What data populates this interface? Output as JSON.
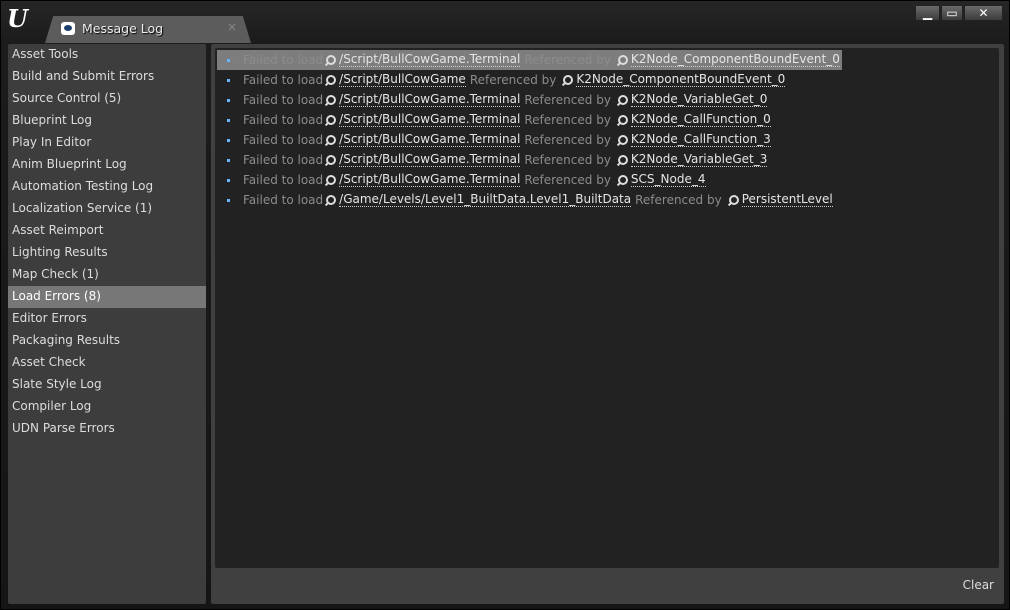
{
  "window": {
    "tab_title": "Message Log",
    "tab_close": "×",
    "minimize": "▁",
    "maximize": "▭",
    "close": "✕",
    "logo": "U"
  },
  "sidebar": {
    "items": [
      {
        "label": "Asset Tools"
      },
      {
        "label": "Build and Submit Errors"
      },
      {
        "label": "Source Control (5)"
      },
      {
        "label": "Blueprint Log"
      },
      {
        "label": "Play In Editor"
      },
      {
        "label": "Anim Blueprint Log"
      },
      {
        "label": "Automation Testing Log"
      },
      {
        "label": "Localization Service (1)"
      },
      {
        "label": "Asset Reimport"
      },
      {
        "label": "Lighting Results"
      },
      {
        "label": "Map Check (1)"
      },
      {
        "label": "Load Errors (8)",
        "selected": true
      },
      {
        "label": "Editor Errors"
      },
      {
        "label": "Packaging Results"
      },
      {
        "label": "Asset Check"
      },
      {
        "label": "Slate Style Log"
      },
      {
        "label": "Compiler Log"
      },
      {
        "label": "UDN Parse Errors"
      }
    ]
  },
  "messages": [
    {
      "prefix": "Failed to load",
      "asset": "/Script/BullCowGame.Terminal",
      "ref": "Referenced by",
      "by": "K2Node_ComponentBoundEvent_0",
      "selected": true
    },
    {
      "prefix": "Failed to load",
      "asset": "/Script/BullCowGame",
      "ref": "Referenced by",
      "by": "K2Node_ComponentBoundEvent_0"
    },
    {
      "prefix": "Failed to load",
      "asset": "/Script/BullCowGame.Terminal",
      "ref": "Referenced by",
      "by": "K2Node_VariableGet_0"
    },
    {
      "prefix": "Failed to load",
      "asset": "/Script/BullCowGame.Terminal",
      "ref": "Referenced by",
      "by": "K2Node_CallFunction_0"
    },
    {
      "prefix": "Failed to load",
      "asset": "/Script/BullCowGame.Terminal",
      "ref": "Referenced by",
      "by": "K2Node_CallFunction_3"
    },
    {
      "prefix": "Failed to load",
      "asset": "/Script/BullCowGame.Terminal",
      "ref": "Referenced by",
      "by": "K2Node_VariableGet_3"
    },
    {
      "prefix": "Failed to load",
      "asset": "/Script/BullCowGame.Terminal",
      "ref": "Referenced by",
      "by": "SCS_Node_4"
    },
    {
      "prefix": "Failed to load",
      "asset": "/Game/Levels/Level1_BuiltData.Level1_BuiltData",
      "ref": "Referenced by",
      "by": "PersistentLevel"
    }
  ],
  "footer": {
    "clear_label": "Clear"
  },
  "colors": {
    "bullet": "#6ab4ff",
    "selected_sidebar": "#777777"
  }
}
